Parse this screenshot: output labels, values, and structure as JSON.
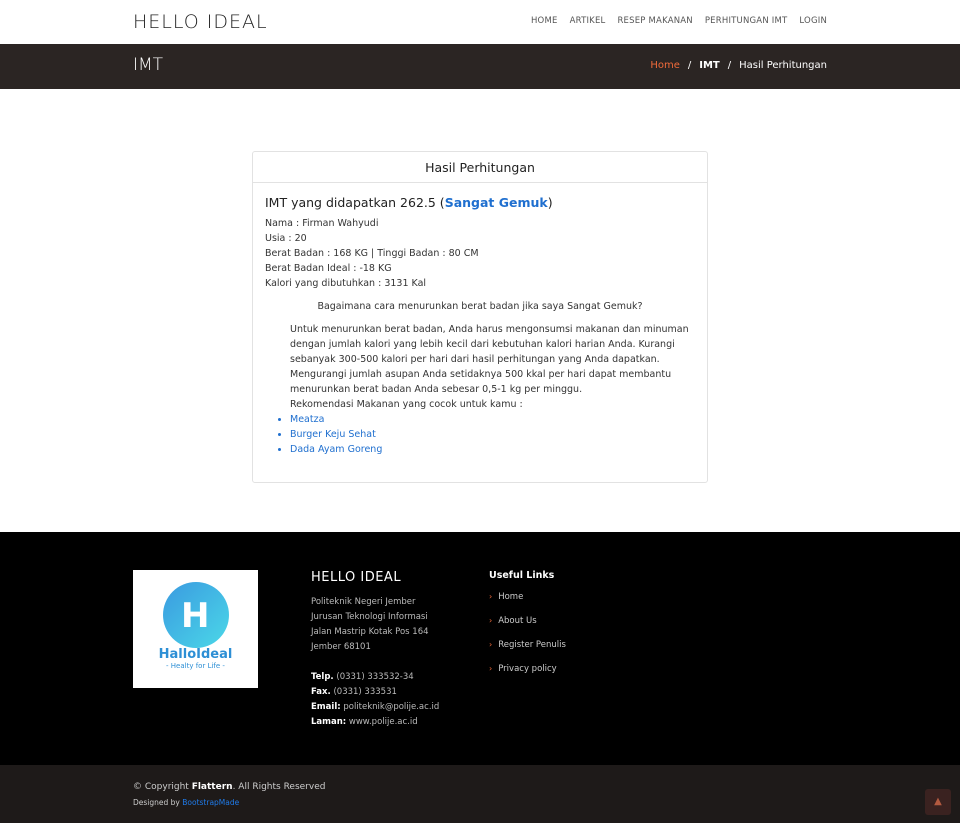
{
  "header": {
    "brand": "HELLO IDEAL",
    "nav": [
      "HOME",
      "ARTIKEL",
      "RESEP MAKANAN",
      "PERHITUNGAN IMT",
      "LOGIN"
    ]
  },
  "band": {
    "title": "IMT",
    "breadcrumb": [
      "Home",
      "IMT",
      "Hasil Perhitungan"
    ],
    "sep": "/"
  },
  "card": {
    "title": "Hasil Perhitungan",
    "imt_prefix": "IMT yang didapatkan 262.5 (",
    "imt_category": "Sangat Gemuk",
    "imt_suffix": ")",
    "info": [
      "Nama : Firman Wahyudi",
      "Usia : 20",
      "Berat Badan : 168 KG | Tinggi Badan : 80 CM",
      "Berat Badan Ideal : -18 KG",
      "Kalori yang dibutuhkan : 3131 Kal"
    ],
    "question": "Bagaimana cara menurunkan berat badan jika saya Sangat Gemuk?",
    "advice": "Untuk menurunkan berat badan, Anda harus mengonsumsi makanan dan minuman dengan jumlah kalori yang lebih kecil dari kebutuhan kalori harian Anda. Kurangi sebanyak 300-500 kalori per hari dari hasil perhitungan yang Anda dapatkan. Mengurangi jumlah asupan Anda setidaknya 500 kkal per hari dapat membantu menurunkan berat badan Anda sebesar 0,5-1 kg per minggu.",
    "rec_label": "Rekomendasi Makanan yang cocok untuk kamu :",
    "recommendations": [
      "Meatza",
      "Burger Keju Sehat",
      "Dada Ayam Goreng"
    ]
  },
  "footer": {
    "logo_name": "HalloIdeal",
    "logo_tag": "- Healty for Life -",
    "title": "HELLO IDEAL",
    "address": [
      "Politeknik Negeri Jember",
      "Jurusan Teknologi Informasi",
      "Jalan Mastrip Kotak Pos 164",
      "Jember 68101"
    ],
    "contacts": [
      {
        "label": "Telp.",
        "value": "(0331) 333532-34"
      },
      {
        "label": "Fax.",
        "value": "(0331) 333531"
      },
      {
        "label": "Email:",
        "value": "politeknik@polije.ac.id"
      },
      {
        "label": "Laman:",
        "value": "www.polije.ac.id"
      }
    ],
    "links_title": "Useful Links",
    "links": [
      "Home",
      "About Us",
      "Register Penulis",
      "Privacy policy"
    ]
  },
  "copyright": {
    "prefix": "© Copyright ",
    "brand": "Flattern",
    "suffix": ". All Rights Reserved",
    "designed_prefix": "Designed by ",
    "designed_by": "BootstrapMade"
  },
  "colors": {
    "accent": "#f06a3a",
    "link": "#1f6fcf",
    "band": "#2b2523",
    "footer": "#000000"
  },
  "icons": {
    "to_top": "chevron-up-icon",
    "link_bullet": "chevron-right-icon"
  }
}
